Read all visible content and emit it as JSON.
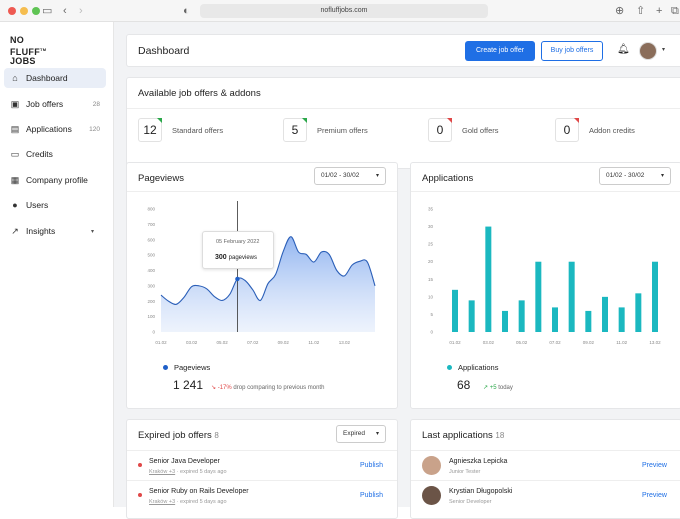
{
  "browser": {
    "url": "nofluffjobs.com"
  },
  "brand": {
    "line1": "NO",
    "line2": "FLUFF",
    "line3": "JOBS",
    "tm": "TM"
  },
  "sidebar": {
    "items": [
      {
        "label": "Dashboard",
        "icon": "home-icon",
        "count": ""
      },
      {
        "label": "Job offers",
        "icon": "briefcase-icon",
        "count": "28"
      },
      {
        "label": "Applications",
        "icon": "applications-icon",
        "count": "120"
      },
      {
        "label": "Credits",
        "icon": "credit-card-icon",
        "count": ""
      },
      {
        "label": "Company profile",
        "icon": "building-icon",
        "count": ""
      },
      {
        "label": "Users",
        "icon": "users-icon",
        "count": ""
      },
      {
        "label": "Insights",
        "icon": "trend-icon",
        "count": ""
      }
    ]
  },
  "header": {
    "title": "Dashboard",
    "create_btn": "Create job offer",
    "buy_btn": "Buy job offers"
  },
  "offers": {
    "title": "Available job offers & addons",
    "items": [
      {
        "value": "12",
        "label": "Standard offers",
        "color": "#2ba84a"
      },
      {
        "value": "5",
        "label": "Premium offers",
        "color": "#2ba84a"
      },
      {
        "value": "0",
        "label": "Gold offers",
        "color": "#e04848"
      },
      {
        "value": "0",
        "label": "Addon credits",
        "color": "#e04848"
      }
    ]
  },
  "pageviews": {
    "title": "Pageviews",
    "range": "01/02 - 30/02",
    "tooltip_date": "05 February 2022",
    "tooltip_value": "300",
    "tooltip_unit": "pageviews",
    "legend": "Pageviews",
    "total": "1 241",
    "change": "-17%",
    "change_text": "drop comparing to previous month"
  },
  "applications": {
    "title": "Applications",
    "range": "01/02 - 30/02",
    "legend": "Applications",
    "total": "68",
    "change": "+5",
    "change_text": "today"
  },
  "chart_data": [
    {
      "type": "area",
      "ylim": [
        0,
        800
      ],
      "yticks": [
        "0",
        "100",
        "200",
        "300",
        "400",
        "500",
        "600",
        "700",
        "800"
      ],
      "xticks": [
        "01.02",
        "03.02",
        "05.02",
        "07.02",
        "09.02",
        "11.02",
        "13.02"
      ],
      "x": [
        0,
        1,
        2,
        3,
        4,
        5,
        6,
        7,
        8,
        9,
        10,
        11,
        12,
        13,
        14,
        15,
        16,
        17,
        18,
        19,
        20,
        21,
        22,
        23,
        24,
        25,
        26,
        27,
        28
      ],
      "values": [
        240,
        200,
        180,
        225,
        295,
        300,
        280,
        230,
        205,
        245,
        345,
        335,
        275,
        205,
        315,
        375,
        525,
        620,
        520,
        505,
        455,
        520,
        505,
        400,
        365,
        435,
        460,
        455,
        300
      ],
      "color": "#2b6fd6"
    },
    {
      "type": "bar",
      "ylim": [
        0,
        35
      ],
      "yticks": [
        "0",
        "5",
        "10",
        "15",
        "20",
        "25",
        "30",
        "35"
      ],
      "xticks": [
        "01.02",
        "03.02",
        "05.02",
        "07.02",
        "09.02",
        "11.02",
        "13.02"
      ],
      "x": [
        1,
        2,
        3,
        4,
        5,
        6,
        7,
        8,
        9,
        10,
        11,
        12,
        13
      ],
      "values": [
        12,
        9,
        30,
        6,
        9,
        20,
        7,
        20,
        6,
        10,
        7,
        11,
        20
      ],
      "color": "#1bb8c0"
    }
  ],
  "expired": {
    "title": "Expired job offers",
    "count": "8",
    "filter": "Expired",
    "rows": [
      {
        "title": "Senior Java Developer",
        "user": "Kraków +3",
        "time": "expired 5 days ago",
        "action": "Publish"
      },
      {
        "title": "Senior Ruby on Rails Developer",
        "user": "Kraków +3",
        "time": "expired 5 days ago",
        "action": "Publish"
      }
    ]
  },
  "last": {
    "title": "Last applications",
    "count": "18",
    "rows": [
      {
        "name": "Agnieszka Lepicka",
        "role": "Junior Tester",
        "action": "Preview"
      },
      {
        "name": "Krystian Długopolski",
        "role": "Senior Developer",
        "action": "Preview"
      }
    ]
  },
  "colors": {
    "accent": "#1f6fe5",
    "up": "#2ba84a",
    "down": "#e04848"
  }
}
